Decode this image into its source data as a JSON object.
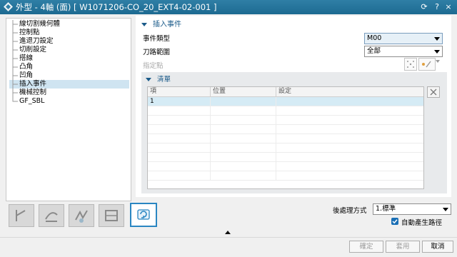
{
  "window": {
    "title": "外型 - 4軸 (面) [ W1071206-CO_20_EXT4-02-001 ]",
    "controls": [
      "⟳",
      "?",
      "×"
    ]
  },
  "tree": {
    "items": [
      {
        "label": "線切割幾何體",
        "selected": false
      },
      {
        "label": "控制點",
        "selected": false
      },
      {
        "label": "進退刀設定",
        "selected": false
      },
      {
        "label": "切削設定",
        "selected": false
      },
      {
        "label": "搭線",
        "selected": false
      },
      {
        "label": "凸角",
        "selected": false
      },
      {
        "label": "凹角",
        "selected": false
      },
      {
        "label": "插入事件",
        "selected": true
      },
      {
        "label": "機械控制",
        "selected": false
      },
      {
        "label": "GF_SBL",
        "selected": false
      }
    ]
  },
  "section": {
    "title": "插入事件",
    "event_type_label": "事件類型",
    "event_type_value": "M00",
    "path_scope_label": "刀路範圍",
    "path_scope_value": "全部",
    "point_label": "指定點"
  },
  "list": {
    "title": "清單",
    "columns": [
      "項",
      "位置",
      "設定"
    ],
    "rows": [
      {
        "item": "1",
        "position": "",
        "setting": ""
      }
    ]
  },
  "toolbar_icons": [
    "tool-icon-1",
    "tool-icon-2",
    "tool-icon-3",
    "tool-icon-4",
    "generate-icon"
  ],
  "postprocess": {
    "label": "後處理方式",
    "value": "1.標準"
  },
  "auto_generate": {
    "label": "自動產生路徑",
    "checked": true
  },
  "buttons": {
    "ok": "確定",
    "apply": "套用",
    "cancel": "取消"
  },
  "colors": {
    "title_bar": "#1d6a91",
    "accent": "#1b5b8a",
    "selection": "#cfe4f1"
  }
}
